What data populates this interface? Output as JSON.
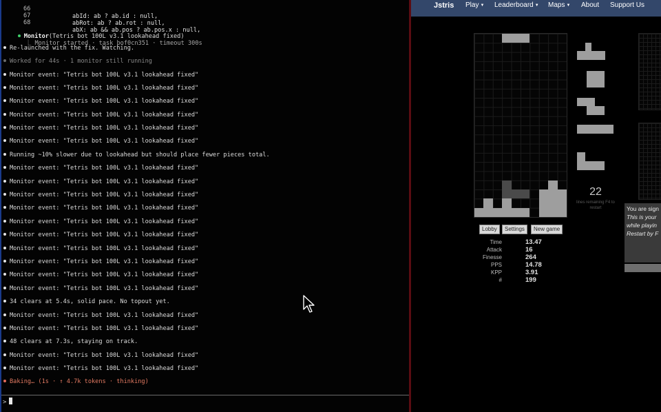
{
  "terminal": {
    "code": [
      {
        "num": "66",
        "text": "abId: ab ? ab.id : null,"
      },
      {
        "num": "67",
        "text": "abRot: ab ? ab.rot : null,"
      },
      {
        "num": "68",
        "text": "abX: ab && ab.pos ? ab.pos.x : null,"
      }
    ],
    "monitor_call": {
      "name": "Monitor",
      "args": "(Tetris bot 100L v3.1 lookahead fixed)"
    },
    "monitor_started": "Monitor started · task bof0cn351 · timeout 300s",
    "relaunched": "Re-launched with the fix. Watching.",
    "worked_for": "Worked for 44s · 1 monitor still running",
    "event_text": "Monitor event: \"Tetris bot 100L v3.1 lookahead fixed\"",
    "running_note": "Running ~10% slower due to lookahead but should place fewer pieces total.",
    "clears_34": "34 clears at 5.4s, solid pace. No topout yet.",
    "clears_48": "48 clears at 7.3s, staying on track.",
    "baking": "Baking… (1s · ↑ 4.7k tokens · thinking)",
    "prompt_symbol": ">"
  },
  "jstris": {
    "nav": {
      "logo": "Jstris",
      "play": "Play",
      "leaderboard": "Leaderboard",
      "maps": "Maps",
      "about": "About",
      "support": "Support Us"
    },
    "remaining": {
      "count": "22",
      "label": "lines remaining F4 to restart"
    },
    "buttons": {
      "lobby": "Lobby",
      "settings": "Settings",
      "new_game": "New game"
    },
    "stats": [
      {
        "label": "Time",
        "value": "13.47"
      },
      {
        "label": "Attack",
        "value": "16"
      },
      {
        "label": "Finesse",
        "value": "264"
      },
      {
        "label": "PPS",
        "value": "14.78"
      },
      {
        "label": "KPP",
        "value": "3.91"
      },
      {
        "label": "#",
        "value": "199"
      }
    ],
    "notice": {
      "line1": "You are sign",
      "line2": "This is your",
      "line3": "while playin",
      "line4": "Restart by F"
    }
  },
  "colors": {
    "nav_bg": "#33476a",
    "block": "#9e9e9e",
    "split_border": "#5a0c12"
  }
}
